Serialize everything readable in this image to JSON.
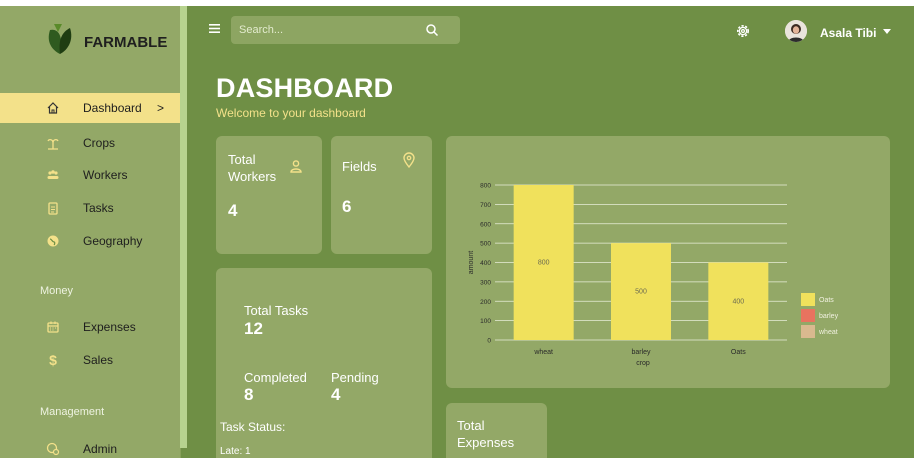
{
  "brand": {
    "name": "FARMABLE"
  },
  "sidebar": {
    "items": [
      {
        "label": "Dashboard",
        "icon": "home-icon",
        "active": true
      },
      {
        "label": "Crops",
        "icon": "sprout-icon"
      },
      {
        "label": "Workers",
        "icon": "people-icon"
      },
      {
        "label": "Tasks",
        "icon": "clipboard-icon"
      },
      {
        "label": "Geography",
        "icon": "globe-icon"
      }
    ],
    "money_label": "Money",
    "money_items": [
      {
        "label": "Expenses",
        "icon": "calendar-icon"
      },
      {
        "label": "Sales",
        "icon": "dollar-icon"
      }
    ],
    "management_label": "Management",
    "management_items": [
      {
        "label": "Admin",
        "icon": "admin-icon"
      }
    ],
    "active_chevron": ">"
  },
  "header": {
    "search_placeholder": "Search...",
    "user_name": "Asala Tibi"
  },
  "page": {
    "title": "DASHBOARD",
    "subtitle": "Welcome to your dashboard"
  },
  "cards": {
    "workers": {
      "label_line1": "Total",
      "label_line2": "Workers",
      "value": "4"
    },
    "fields": {
      "label": "Fields",
      "value": "6"
    },
    "tasks": {
      "total_label": "Total Tasks",
      "total_value": "12",
      "completed_label": "Completed",
      "completed_value": "8",
      "pending_label": "Pending",
      "pending_value": "4",
      "status_label": "Task Status:",
      "late_text": "Late: 1"
    },
    "expenses": {
      "label_line1": "Total",
      "label_line2": "Expenses"
    }
  },
  "colors": {
    "background": "#6f8f45",
    "card": "#93a867",
    "accent": "#f3e18a",
    "bar": "#f0e15c"
  },
  "chart_data": {
    "type": "bar",
    "categories": [
      "wheat",
      "barley",
      "Oats"
    ],
    "values": [
      800,
      500,
      400
    ],
    "value_labels": [
      "800",
      "500",
      "400"
    ],
    "xlabel": "crop",
    "ylabel": "amount",
    "ylim": [
      0,
      800
    ],
    "yticks": [
      0,
      100,
      200,
      300,
      400,
      500,
      600,
      700,
      800
    ],
    "grid": true,
    "legend": [
      {
        "label": "Oats",
        "color": "#f0e15c"
      },
      {
        "label": "barley",
        "color": "#e8735f"
      },
      {
        "label": "wheat",
        "color": "#d9b98f"
      }
    ],
    "legend_position": "right"
  }
}
